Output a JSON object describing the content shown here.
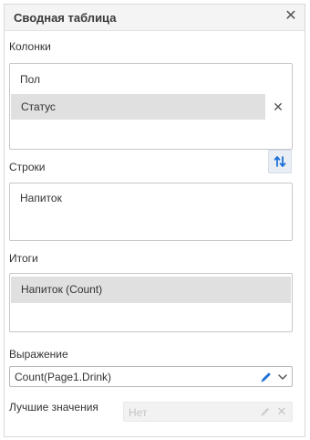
{
  "panel": {
    "title": "Сводная таблица",
    "close_glyph": "✕"
  },
  "columns": {
    "label": "Колонки",
    "items": [
      {
        "label": "Пол",
        "selected": false
      },
      {
        "label": "Статус",
        "selected": true
      }
    ],
    "remove_glyph": "✕"
  },
  "rows": {
    "label": "Строки",
    "swap_icon": "swap-vertical-icon",
    "items": [
      {
        "label": "Напиток"
      }
    ]
  },
  "totals": {
    "label": "Итоги",
    "items": [
      {
        "label": "Напиток (Count)",
        "selected": true
      }
    ]
  },
  "expression": {
    "label": "Выражение",
    "value": "Count(Page1.Drink)"
  },
  "best_values": {
    "label": "Лучшие значения",
    "value": "Нет",
    "clear_glyph": "✕"
  },
  "colors": {
    "accent": "#1e6fd9",
    "selected_bg": "#e0e0e0",
    "header_bg": "#f4f4f4"
  }
}
